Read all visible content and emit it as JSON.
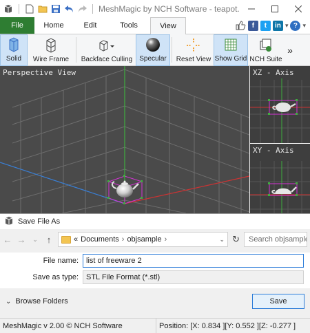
{
  "window": {
    "title": "MeshMagic by NCH Software - teapot.obj",
    "controls": [
      "minimize",
      "maximize",
      "close"
    ]
  },
  "ribbon_tabs": [
    "File",
    "Home",
    "Edit",
    "Tools",
    "View"
  ],
  "active_tab": "View",
  "toolbar": {
    "solid": "Solid",
    "wire_frame": "Wire Frame",
    "backface_culling": "Backface Culling",
    "specular": "Specular",
    "reset_view": "Reset View",
    "show_grid": "Show Grid",
    "nch_suite": "NCH Suite",
    "more": "»"
  },
  "viewports": {
    "perspective": "Perspective View",
    "xz": "XZ - Axis",
    "xy": "XY - Axis"
  },
  "dialog": {
    "title": "Save File As",
    "breadcrumb_prefix": "«",
    "breadcrumb": [
      "Documents",
      "objsample"
    ],
    "search_placeholder": "Search objsample",
    "file_name_label": "File name:",
    "file_name_value": "list of freeware 2",
    "save_type_label": "Save as type:",
    "save_type_value": "STL File Format (*.stl)",
    "browse_folders": "Browse Folders",
    "save_button": "Save"
  },
  "status": {
    "version": "MeshMagic v 2.00 © NCH Software",
    "position": "Position: [X: 0.834 ][Y: 0.552 ][Z: -0.277 ]"
  },
  "colors": {
    "file_tab": "#2e7d32",
    "viewport_bg": "#4a4a4a",
    "grid": "#6d6d6d",
    "axis_green": "#3fae3f",
    "axis_blue": "#3a7fd5",
    "axis_red": "#cc3333",
    "selection_magenta": "#d633d6"
  }
}
